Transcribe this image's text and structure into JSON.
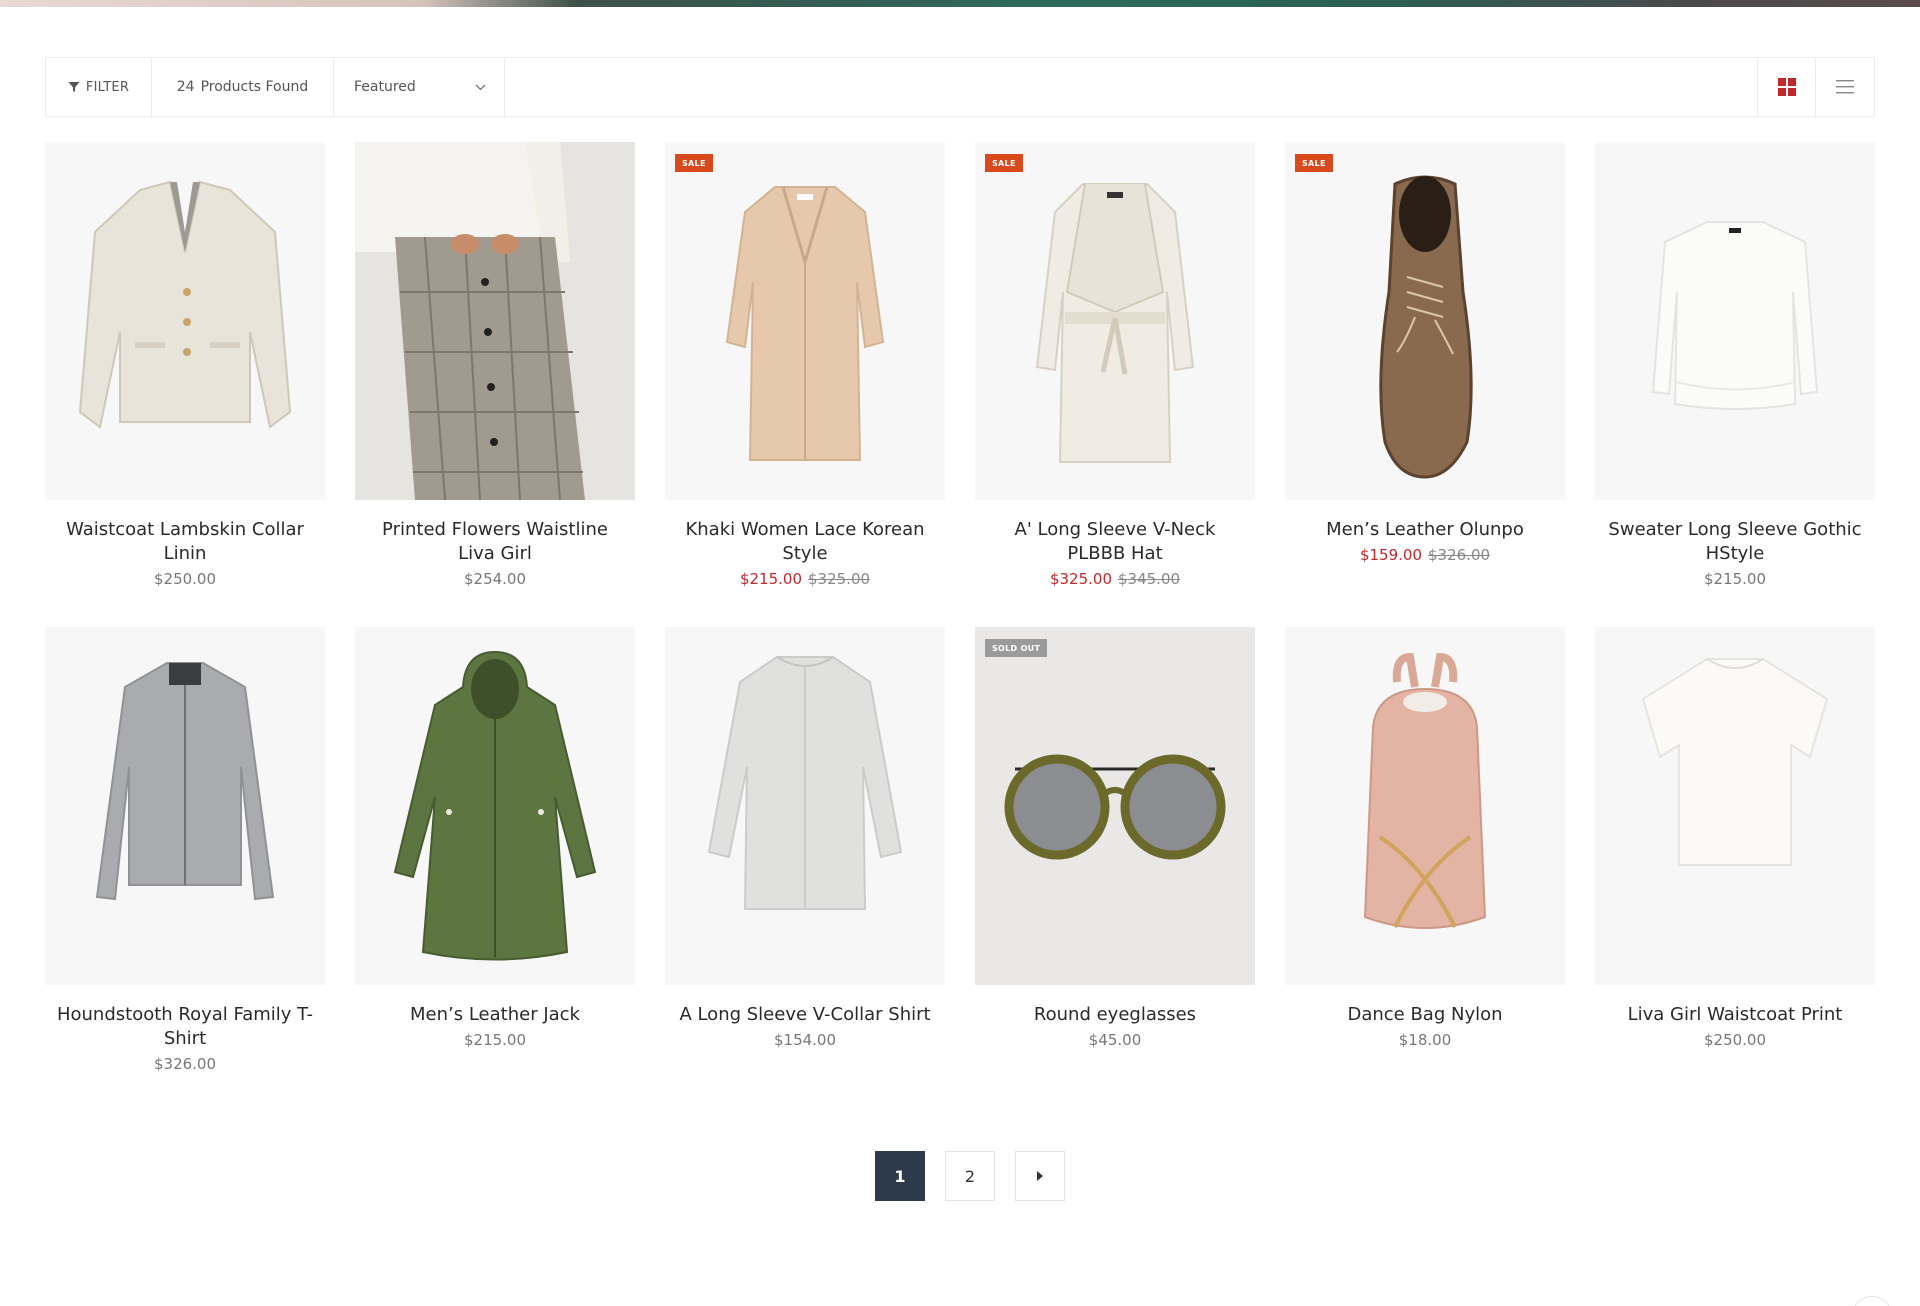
{
  "toolbar": {
    "filter_label": "FILTER",
    "filter_icon": "funnel-icon",
    "product_count": "24",
    "products_found_label": "Products Found",
    "sort_selected": "Featured",
    "sort_icon": "chevron-down-icon",
    "grid_view_icon": "grid-view-icon",
    "list_view_icon": "list-view-icon",
    "accent_color": "#c0282d"
  },
  "products": [
    {
      "title": "Waistcoat Lambskin Collar Linin",
      "price": "$250.00",
      "sale_price": "",
      "old_price": "",
      "badge": "",
      "image": "cream-blazer"
    },
    {
      "title": "Printed Flowers Waistline Liva Girl",
      "price": "$254.00",
      "sale_price": "",
      "old_price": "",
      "badge": "",
      "image": "plaid-skirt"
    },
    {
      "title": "Khaki Women Lace Korean Style",
      "price": "",
      "sale_price": "$215.00",
      "old_price": "$325.00",
      "badge": "SALE",
      "image": "beige-coat"
    },
    {
      "title": "A' Long Sleeve V-Neck PLBBB Hat",
      "price": "",
      "sale_price": "$325.00",
      "old_price": "$345.00",
      "badge": "SALE",
      "image": "cream-wrap-coat"
    },
    {
      "title": "Men’s Leather Olunpo",
      "price": "",
      "sale_price": "$159.00",
      "old_price": "$326.00",
      "badge": "SALE",
      "image": "suede-boot"
    },
    {
      "title": "Sweater Long Sleeve Gothic HStyle",
      "price": "$215.00",
      "sale_price": "",
      "old_price": "",
      "badge": "",
      "image": "white-blouse"
    },
    {
      "title": "Houndstooth Royal Family T-Shirt",
      "price": "$326.00",
      "sale_price": "",
      "old_price": "",
      "badge": "",
      "image": "grey-zip-cardigan"
    },
    {
      "title": "Men’s Leather Jack",
      "price": "$215.00",
      "sale_price": "",
      "old_price": "",
      "badge": "",
      "image": "green-parka"
    },
    {
      "title": "A Long Sleeve V-Collar Shirt",
      "price": "$154.00",
      "sale_price": "",
      "old_price": "",
      "badge": "",
      "image": "light-grey-coat"
    },
    {
      "title": "Round eyeglasses",
      "price": "$45.00",
      "sale_price": "",
      "old_price": "",
      "badge": "SOLD OUT",
      "image": "round-sunglasses"
    },
    {
      "title": "Dance Bag Nylon",
      "price": "$18.00",
      "sale_price": "",
      "old_price": "",
      "badge": "",
      "image": "pink-backpack"
    },
    {
      "title": "Liva Girl Waistcoat Print",
      "price": "$250.00",
      "sale_price": "",
      "old_price": "",
      "badge": "",
      "image": "white-tshirt"
    }
  ],
  "pagination": {
    "pages": [
      "1",
      "2"
    ],
    "current": "1",
    "next_icon": "caret-right-icon"
  }
}
